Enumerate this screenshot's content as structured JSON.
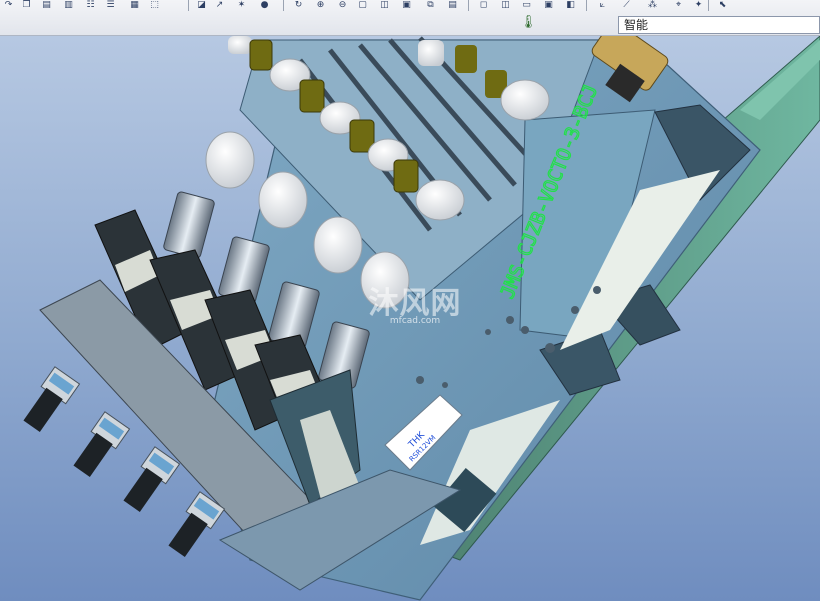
{
  "toolbar": {
    "filter_value": "智能"
  },
  "model": {
    "part_engraving": "JMS-CJZB-VOCTO-3-BCJ",
    "label_brand": "THK",
    "label_model": "RSR12VM"
  },
  "watermark": {
    "brand": "沐风网",
    "site": "mfcad.com"
  },
  "colors": {
    "viewport_top": "#b6c8e2",
    "viewport_bottom": "#6f8dbf",
    "engraving_green": "#22e04a",
    "plate_blue": "#6f9ab6",
    "motor_dark": "#2b3338"
  }
}
